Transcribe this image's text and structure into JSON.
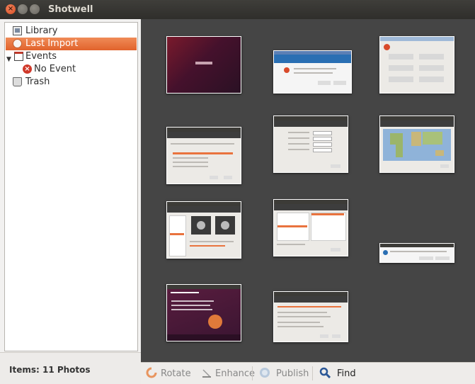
{
  "app": {
    "title": "Shotwell"
  },
  "sidebar": {
    "items": [
      {
        "label": "Library"
      },
      {
        "label": "Last Import"
      },
      {
        "label": "Events"
      },
      {
        "label": "No Event"
      },
      {
        "label": "Trash"
      }
    ]
  },
  "status": {
    "items_text": "Items: 11 Photos"
  },
  "toolbar": {
    "rotate_label": "Rotate",
    "enhance_label": "Enhance",
    "publish_label": "Publish",
    "find_label": "Find"
  },
  "colors": {
    "selection": "#e9733e",
    "viewer_bg": "#454545",
    "titlebar": "#3c3b37"
  },
  "icons": [
    "library-icon",
    "last-import-icon",
    "events-icon",
    "no-event-icon",
    "trash-icon",
    "rotate-icon",
    "enhance-icon",
    "publish-icon",
    "find-icon"
  ]
}
